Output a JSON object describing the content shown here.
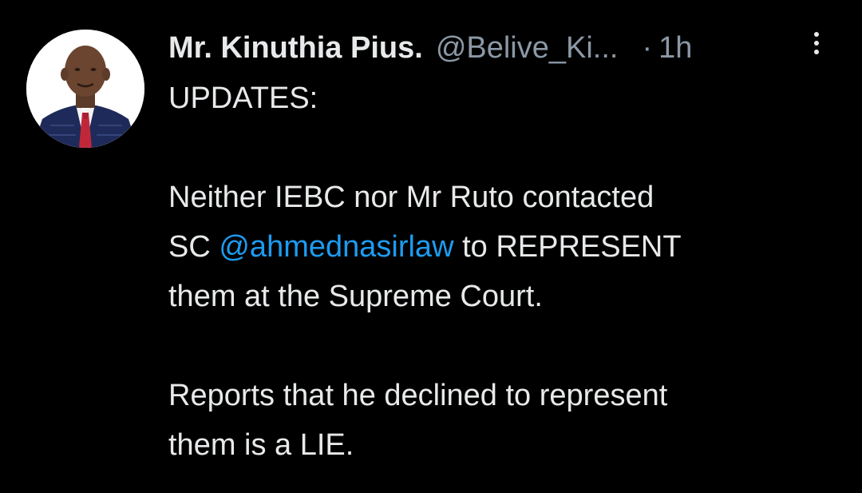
{
  "tweet": {
    "author_name": "Mr. Kinuthia Pius.",
    "handle": "@Belive_Ki...",
    "separator": "·",
    "time": "1h",
    "more_icon": "more-vertical-icon",
    "avatar_icon": "profile-photo",
    "lines": {
      "l1": "UPDATES:",
      "l3": "Neither IEBC nor Mr Ruto contacted",
      "l4_prefix": "SC ",
      "l4_mention": "@ahmednasirlaw",
      "l4_suffix": " to REPRESENT",
      "l5": "them at the Supreme Court.",
      "l7": "Reports that he declined to represent",
      "l8": "them is a LIE."
    }
  },
  "colors": {
    "background": "#000000",
    "text": "#e7e9ea",
    "secondary_text": "#8b98a5",
    "mention": "#1d9bf0"
  }
}
